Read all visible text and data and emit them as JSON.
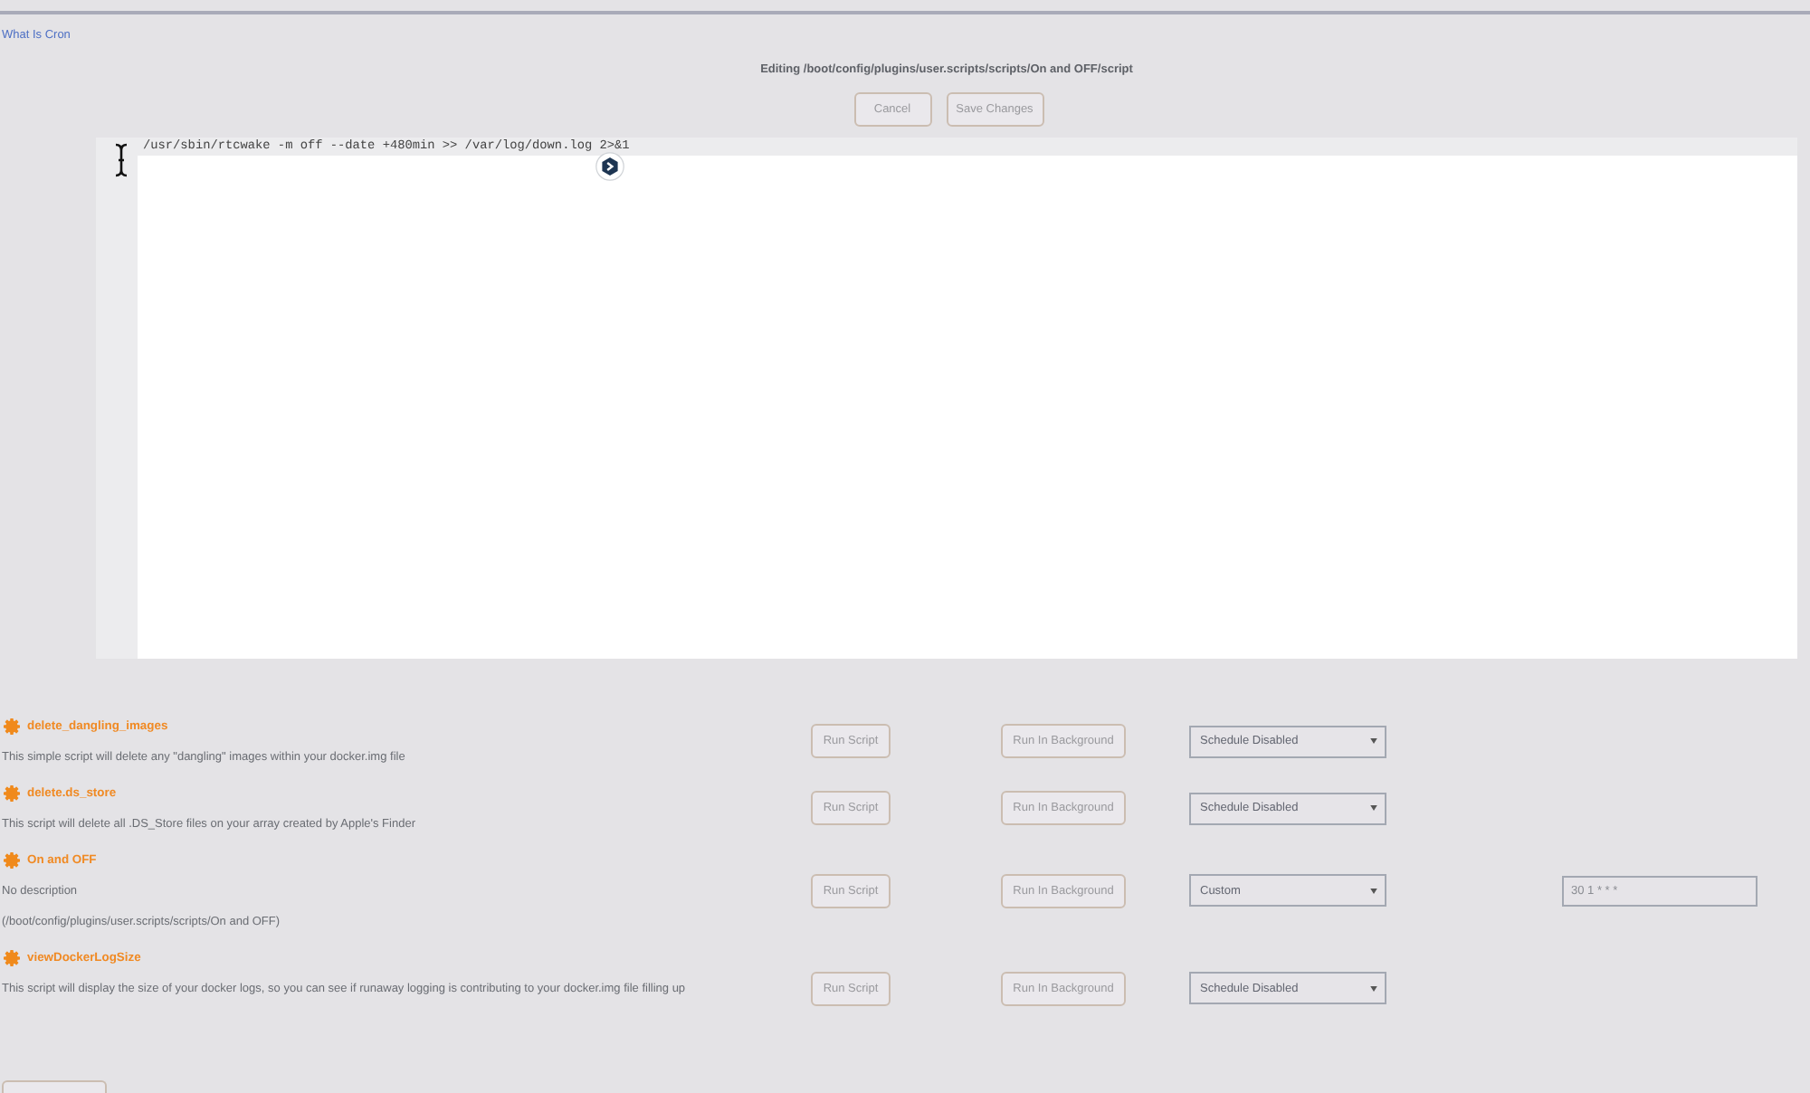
{
  "header": {
    "link": "What Is Cron",
    "title": "Editing /boot/config/plugins/user.scripts/scripts/On and OFF/script",
    "cancel_button": "Cancel",
    "save_button": "Save Changes"
  },
  "editor": {
    "lines": [
      {
        "text": "/usr/sbin/rtcwake -m off --date +480min >> /var/log/down.log 2>&1",
        "active": true
      }
    ]
  },
  "scripts": [
    {
      "name": "delete_dangling_images",
      "description_lines": [
        "This simple script will delete any \"dangling\" images within your docker.img file"
      ],
      "run_button": "Run Script",
      "background_button": "Run In Background",
      "schedule": "Schedule Disabled"
    },
    {
      "name": "delete.ds_store",
      "description_lines": [
        "This script will delete all .DS_Store files on your array created by Apple's Finder"
      ],
      "run_button": "Run Script",
      "background_button": "Run In Background",
      "schedule": "Schedule Disabled"
    },
    {
      "name": "On and OFF",
      "description_lines": [
        "No description",
        "(/boot/config/plugins/user.scripts/scripts/On and OFF)"
      ],
      "run_button": "Run Script",
      "background_button": "Run In Background",
      "schedule": "Custom",
      "custom_schedule": "30 1 * * *"
    },
    {
      "name": "viewDockerLogSize",
      "description_lines": [
        "This script will display the size of your docker logs, so you can see if runaway logging is contributing to your docker.img file filling up"
      ],
      "run_button": "Run Script",
      "background_button": "Run In Background",
      "schedule": "Schedule Disabled"
    }
  ]
}
